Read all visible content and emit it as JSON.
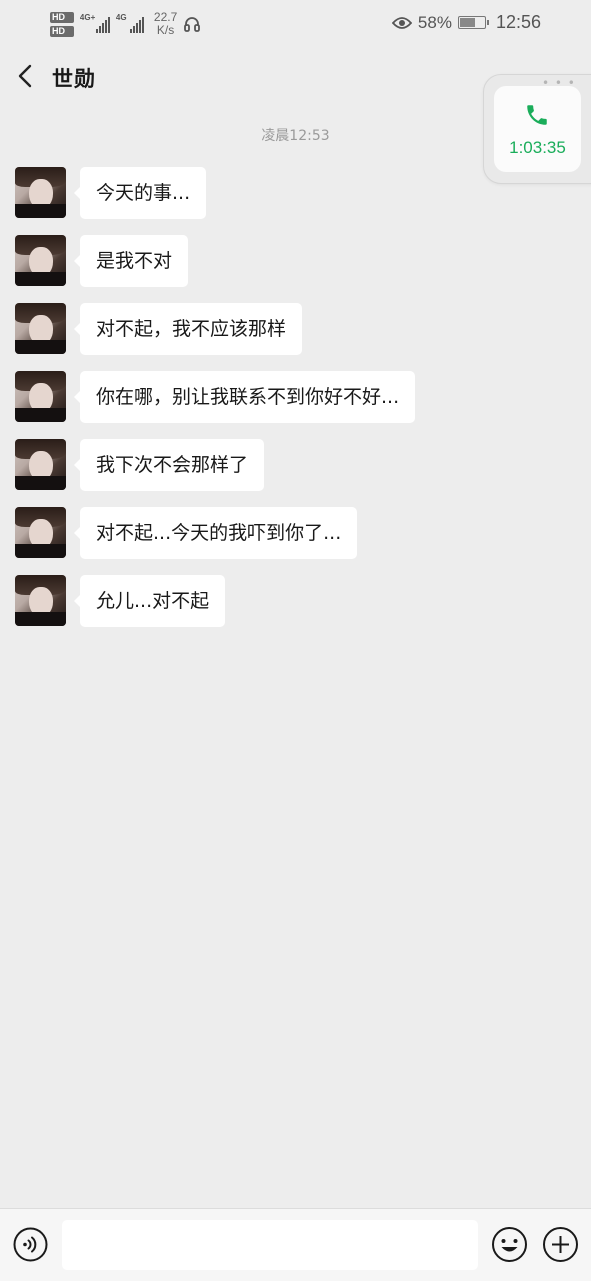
{
  "status_bar": {
    "hd1": "HD",
    "hd1_sub": "1",
    "hd2": "HD",
    "hd2_sub": "2",
    "network1": "4G+",
    "network2": "4G",
    "speed_value": "22.7",
    "speed_unit": "K/s",
    "battery_percent": "58%",
    "battery_level": 0.58,
    "time": "12:56",
    "icons": [
      "headset-icon",
      "eye-icon",
      "battery-icon"
    ]
  },
  "header": {
    "back_icon": "chevron-left-icon",
    "title": "世勋"
  },
  "call_float": {
    "duration": "1:03:35",
    "icon": "phone-icon",
    "accent": "#1aad5a"
  },
  "chat": {
    "timestamp": "凌晨12:53",
    "messages": [
      {
        "text": "今天的事..."
      },
      {
        "text": "是我不对"
      },
      {
        "text": "对不起，我不应该那样"
      },
      {
        "text": "你在哪，别让我联系不到你好不好..."
      },
      {
        "text": "我下次不会那样了"
      },
      {
        "text": "对不起...今天的我吓到你了..."
      },
      {
        "text": "允儿...对不起"
      }
    ]
  },
  "input_bar": {
    "voice_icon": "voice-input-icon",
    "emoji_icon": "emoji-icon",
    "plus_icon": "plus-icon",
    "input_value": "",
    "placeholder": ""
  },
  "colors": {
    "background": "#ededed",
    "bubble": "#ffffff",
    "accent_green": "#1aad5a"
  }
}
